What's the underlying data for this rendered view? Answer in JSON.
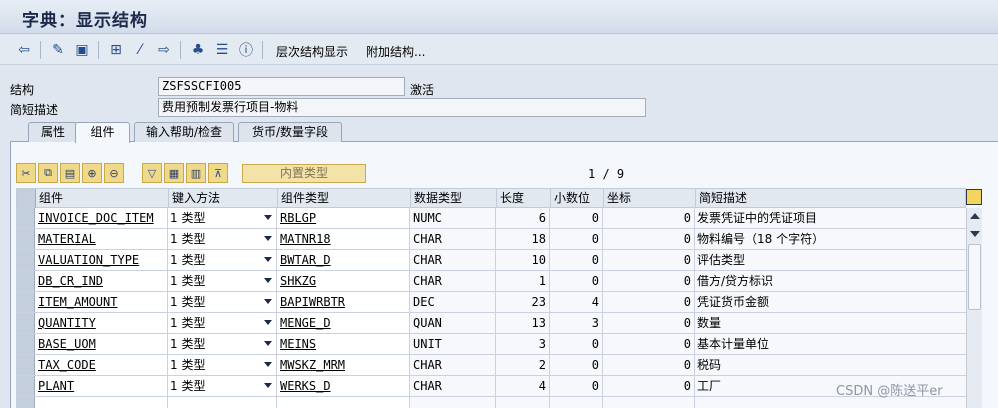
{
  "window": {
    "title": "字典：显示结构"
  },
  "toolbar": {
    "icons": [
      "back-arrow-icon",
      "display-change-icon",
      "object-icon",
      "hierarchy-icon",
      "wand-icon",
      "export-icon",
      "tree-icon",
      "align-icon",
      "info-icon"
    ],
    "hierarchy_label": "层次结构显示",
    "append_label": "附加结构..."
  },
  "form": {
    "structure_label": "结构",
    "structure_value": "ZSFSSCFI005",
    "status": "激活",
    "desc_label": "简短描述",
    "desc_value": "费用预制发票行项目-物料"
  },
  "tabs": [
    "属性",
    "组件",
    "输入帮助/检查",
    "货币/数量字段"
  ],
  "gridbar": {
    "builtin_type_label": "内置类型",
    "counter": "1 / 9"
  },
  "columns": [
    "组件",
    "键入方法",
    "组件类型",
    "数据类型",
    "长度",
    "小数位",
    "坐标",
    "简短描述"
  ],
  "rows": [
    {
      "component": "INVOICE_DOC_ITEM",
      "method": "1 类型",
      "ctype": "RBLGP",
      "dtype": "NUMC",
      "length": "6",
      "decimals": "0",
      "coord": "0",
      "desc": "发票凭证中的凭证项目"
    },
    {
      "component": "MATERIAL",
      "method": "1 类型",
      "ctype": "MATNR18",
      "dtype": "CHAR",
      "length": "18",
      "decimals": "0",
      "coord": "0",
      "desc": "物料编号（18 个字符）"
    },
    {
      "component": "VALUATION_TYPE",
      "method": "1 类型",
      "ctype": "BWTAR_D",
      "dtype": "CHAR",
      "length": "10",
      "decimals": "0",
      "coord": "0",
      "desc": "评估类型"
    },
    {
      "component": "DB_CR_IND",
      "method": "1 类型",
      "ctype": "SHKZG",
      "dtype": "CHAR",
      "length": "1",
      "decimals": "0",
      "coord": "0",
      "desc": "借方/贷方标识"
    },
    {
      "component": "ITEM_AMOUNT",
      "method": "1 类型",
      "ctype": "BAPIWRBTR",
      "dtype": "DEC",
      "length": "23",
      "decimals": "4",
      "coord": "0",
      "desc": "凭证货币金额"
    },
    {
      "component": "QUANTITY",
      "method": "1 类型",
      "ctype": "MENGE_D",
      "dtype": "QUAN",
      "length": "13",
      "decimals": "3",
      "coord": "0",
      "desc": "数量"
    },
    {
      "component": "BASE_UOM",
      "method": "1 类型",
      "ctype": "MEINS",
      "dtype": "UNIT",
      "length": "3",
      "decimals": "0",
      "coord": "0",
      "desc": "基本计量单位"
    },
    {
      "component": "TAX_CODE",
      "method": "1 类型",
      "ctype": "MWSKZ_MRM",
      "dtype": "CHAR",
      "length": "2",
      "decimals": "0",
      "coord": "0",
      "desc": "税码"
    },
    {
      "component": "PLANT",
      "method": "1 类型",
      "ctype": "WERKS_D",
      "dtype": "CHAR",
      "length": "4",
      "decimals": "0",
      "coord": "0",
      "desc": "工厂"
    }
  ],
  "watermark": "CSDN @陈送平er"
}
